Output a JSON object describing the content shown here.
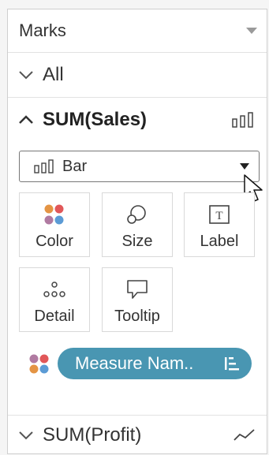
{
  "marks": {
    "title": "Marks"
  },
  "all": {
    "label": "All"
  },
  "sales": {
    "label": "SUM(Sales)"
  },
  "mark_type": {
    "value": "Bar"
  },
  "cards": {
    "color": "Color",
    "size": "Size",
    "label": "Label",
    "detail": "Detail",
    "tooltip": "Tooltip"
  },
  "pill": {
    "label": "Measure Nam.."
  },
  "profit": {
    "label": "SUM(Profit)"
  },
  "colors": {
    "pill": "#4996b2",
    "dot_orange": "#e49444",
    "dot_purple": "#b07aa1",
    "dot_red": "#e15759",
    "dot_blue": "#5b9bd5"
  }
}
